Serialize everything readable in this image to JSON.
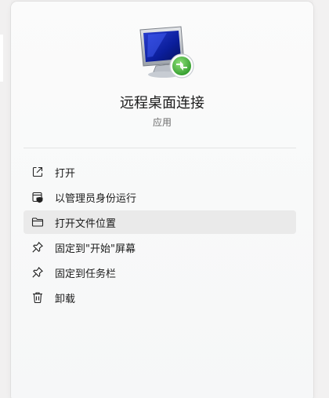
{
  "app": {
    "name": "远程桌面连接",
    "type": "应用"
  },
  "menu": {
    "items": [
      {
        "label": "打开",
        "icon": "open-external-icon"
      },
      {
        "label": "以管理员身份运行",
        "icon": "admin-shield-icon"
      },
      {
        "label": "打开文件位置",
        "icon": "folder-icon"
      },
      {
        "label": "固定到\"开始\"屏幕",
        "icon": "pin-icon"
      },
      {
        "label": "固定到任务栏",
        "icon": "pin-icon"
      },
      {
        "label": "卸载",
        "icon": "trash-icon"
      }
    ]
  }
}
